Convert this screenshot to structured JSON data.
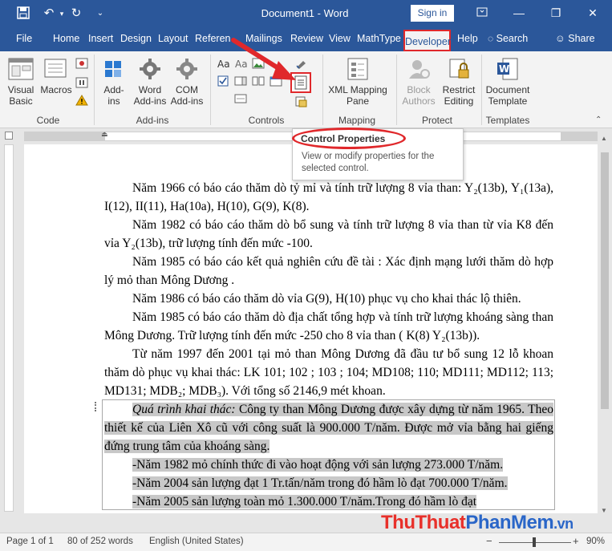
{
  "window": {
    "title": "Document1  -  Word",
    "signin": "Sign in",
    "accent": "#2b579a",
    "highlight_red": "#e0282b"
  },
  "tabs": {
    "file": "File",
    "home": "Home",
    "insert": "Insert",
    "design": "Design",
    "layout": "Layout",
    "references": "Referen",
    "mailings": "Mailings",
    "review": "Review",
    "view": "View",
    "mathtype": "MathType",
    "developer": "Developer",
    "help": "Help",
    "search": "Search",
    "share": "Share"
  },
  "ribbon": {
    "code": {
      "visual_basic_1": "Visual",
      "visual_basic_2": "Basic",
      "macros": "Macros",
      "label": "Code"
    },
    "addins": {
      "addins_1": "Add-",
      "addins_2": "ins",
      "word_addins_1": "Word",
      "word_addins_2": "Add-ins",
      "com_addins_1": "COM",
      "com_addins_2": "Add-ins",
      "label": "Add-ins"
    },
    "controls": {
      "label": "Controls"
    },
    "mapping": {
      "xml_1": "XML Mapping",
      "xml_2": "Pane",
      "label": "Mapping"
    },
    "protect": {
      "block_1": "Block",
      "block_2": "Authors",
      "restrict_1": "Restrict",
      "restrict_2": "Editing",
      "label": "Protect"
    },
    "templates": {
      "doc_template_1": "Document",
      "doc_template_2": "Template",
      "label": "Templates"
    }
  },
  "tooltip": {
    "title": "Control Properties",
    "description": "View or modify properties for the selected control."
  },
  "document": {
    "p1": "Năm 1966 có báo cáo thăm dò tỷ mỉ và tính trữ lượng 8 vỉa than: Y₂(13b), Y₁(13a), I(12), II(11), Ha(10a), H(10), G(9), K(8).",
    "p2": "Năm 1982 có báo cáo thăm dò bổ sung và tính trữ lượng 8 vỉa than từ vỉa K8 đến vỉa Y₂(13b), trữ lượng tính đến mức -100.",
    "p3": "Năm 1985 có báo cáo kết quả nghiên cứu đề tài : Xác định mạng lưới thăm dò hợp lý mỏ than Mông Dương .",
    "p4": "Năm 1986 có báo cáo thăm dò vỉa G(9), H(10) phục vụ cho khai thác lộ thiên.",
    "p5": "Năm 1985 có báo cáo thăm dò địa chất tổng hợp và tính trữ  lượng khoáng sàng than Mông Dương. Trữ lượng tính đến mức -250 cho 8 vỉa than ( K(8)  Y₂(13b)).",
    "p6": "Từ năm 1997 đến 2001 tại mỏ than Mông Dương đã đầu tư bổ sung 12 lỗ khoan thăm dò phục vụ khai thác: LK 101; 102 ; 103 ; 104; MD108; 110; MD111; MD112; 113; MD131; MDB₂; MDB₃). Với tổng số 2146,9 mét khoan.",
    "p7_label": "Quá trình khai thác:",
    "p7_text": "  Công ty than Mông Dương được xây dựng từ  năm 1965. Theo thiết kế của Liên Xô cũ với công suất là 900.000 T/năm. Được mở vỉa bằng hai giếng đứng trung tâm của khoáng sàng.",
    "l1": "-Năm 1982 mỏ chính thức đi vào hoạt động với sản lượng 273.000 T/năm.",
    "l2": "-Năm 2004 sản lượng đạt 1 Tr.tấn/năm trong đó hầm lò đạt  700.000 T/năm.",
    "l3": "-Năm 2005 sản lượng toàn mỏ 1.300.000 T/năm.Trong đó hầm lò đạt"
  },
  "status": {
    "page": "Page 1 of 1",
    "words": "80 of 252 words",
    "language": "English (United States)",
    "zoom": "90%"
  },
  "watermark": {
    "part1": "ThuThuat",
    "part2": "PhanMem",
    "part3": ".vn"
  }
}
